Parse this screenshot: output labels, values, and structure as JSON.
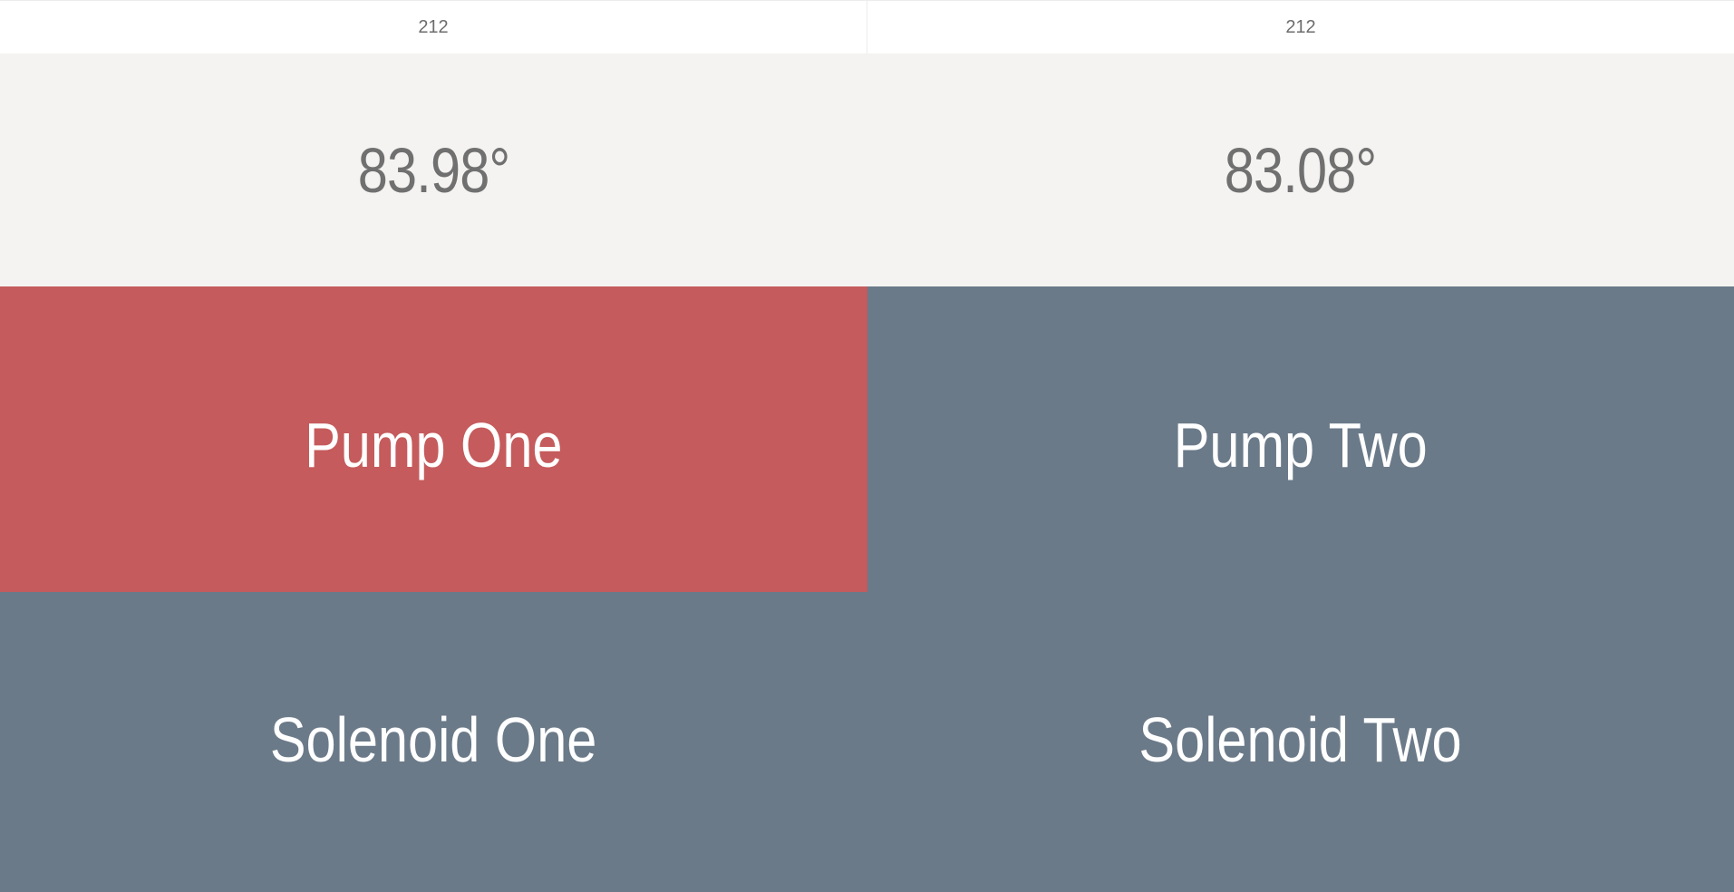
{
  "sensors": [
    {
      "id_label": "212",
      "temperature": "83.98°"
    },
    {
      "id_label": "212",
      "temperature": "83.08°"
    }
  ],
  "controls": {
    "pump_one": {
      "label": "Pump One",
      "state": "on"
    },
    "pump_two": {
      "label": "Pump Two",
      "state": "off"
    },
    "solenoid_one": {
      "label": "Solenoid One",
      "state": "off"
    },
    "solenoid_two": {
      "label": "Solenoid Two",
      "state": "off"
    }
  },
  "colors": {
    "active": "#c55b5c",
    "inactive": "#6b7a89",
    "temp_background": "#f4f3f1",
    "header_background": "#ffffff",
    "text_dark": "#707070",
    "text_light": "#ffffff"
  }
}
